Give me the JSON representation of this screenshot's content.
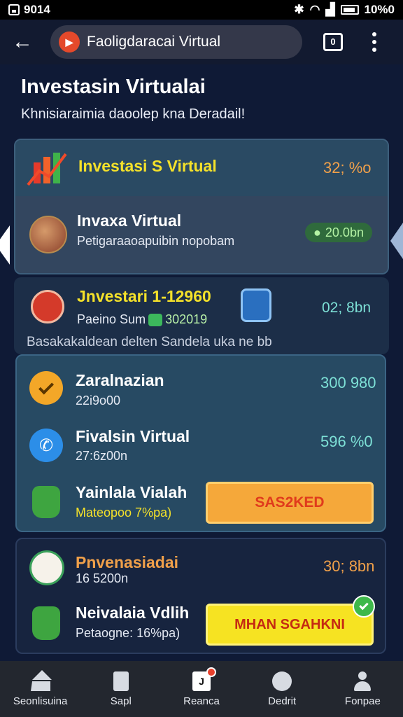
{
  "status_bar": {
    "time": "9014",
    "battery": "10%0"
  },
  "app_bar": {
    "url_title": "Faoligdaracai Virtual",
    "tab_label": "0"
  },
  "page": {
    "title": "Investasin Virtualai",
    "subtitle": "Khnisiaraimia daoolep kna Deradail!"
  },
  "card_a": {
    "header_title": "Investasi S Virtual",
    "header_value": "32; %o",
    "row_title": "Invaxa Virtual",
    "row_subtitle": "Petigaraaoapuibin nopobam",
    "row_badge": "20.0bn"
  },
  "section2": {
    "title": "Jnvestari 1-12960",
    "sub_prefix": "Paeino Sum",
    "sub_value": "302019",
    "value": "02; 8bn",
    "note": "Basakakaldean delten Sandela uka ne bb"
  },
  "card_b": {
    "items": [
      {
        "title": "Zaralnazian",
        "subtitle": "22i9o00",
        "value": "300 980"
      },
      {
        "title": "Fivalsin Virtual",
        "subtitle": "27:6z00n",
        "value": "596 %0"
      },
      {
        "title": "Yainlala Vialah",
        "subtitle": "Mateopoo 7%pa)"
      }
    ],
    "button_label": "SAS2KED"
  },
  "card_c": {
    "items": [
      {
        "title": "Pnvenasiadai",
        "subtitle": "16 5200n",
        "value": "30; 8bn"
      },
      {
        "title": "Neivalaia Vdlih",
        "subtitle": "Petaogne: 16%pa)"
      }
    ],
    "button_label": "MHAN SGAHKNI"
  },
  "bottom_nav": [
    {
      "label": "Seonlisuina",
      "icon": "home-icon"
    },
    {
      "label": "Sapl",
      "icon": "document-icon"
    },
    {
      "label": "Reanca",
      "icon": "news-icon"
    },
    {
      "label": "Dedrit",
      "icon": "chat-icon"
    },
    {
      "label": "Fonpae",
      "icon": "profile-icon"
    }
  ],
  "colors": {
    "accent_yellow": "#f4e12a",
    "value_orange": "#f0a04a",
    "value_teal": "#7de0d6",
    "button_orange": "#f5a83a",
    "button_yellow": "#f6e322"
  }
}
